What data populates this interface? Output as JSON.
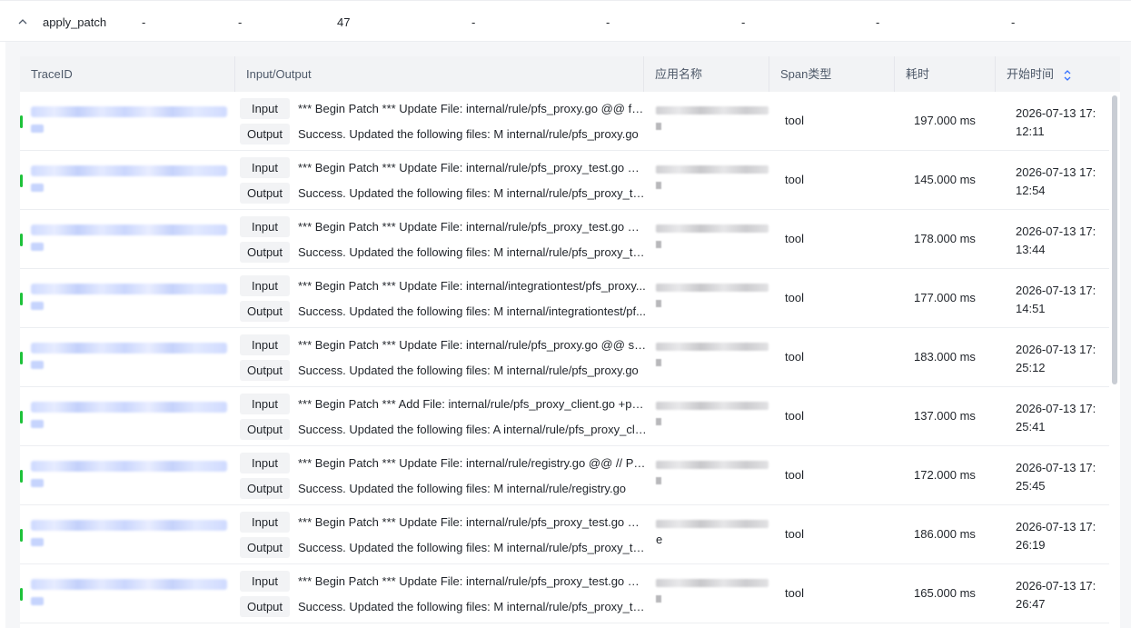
{
  "summary": {
    "name": "apply_patch",
    "cells": [
      "-",
      "-",
      "47",
      "-",
      "-",
      "-",
      "-",
      "-"
    ]
  },
  "columns": {
    "trace_id": "TraceID",
    "io": "Input/Output",
    "app_name": "应用名称",
    "span_type": "Span类型",
    "duration": "耗时",
    "start_time": "开始时间"
  },
  "io_labels": {
    "input": "Input",
    "output": "Output"
  },
  "colors": {
    "status_ok": "#1ec23a",
    "trace_link": "#c6d4ff"
  },
  "rows": [
    {
      "input": "*** Begin Patch *** Update File: internal/rule/pfs_proxy.go @@ for ...",
      "output": "Success. Updated the following files: M internal/rule/pfs_proxy.go",
      "span_type": "tool",
      "duration": "197.000 ms",
      "start_date": "2026-07-13 17:",
      "start_clock": "12:11",
      "app_tail": ""
    },
    {
      "input": "*** Begin Patch *** Update File: internal/rule/pfs_proxy_test.go @...",
      "output": "Success. Updated the following files: M internal/rule/pfs_proxy_te...",
      "span_type": "tool",
      "duration": "145.000 ms",
      "start_date": "2026-07-13 17:",
      "start_clock": "12:54",
      "app_tail": ""
    },
    {
      "input": "*** Begin Patch *** Update File: internal/rule/pfs_proxy_test.go @...",
      "output": "Success. Updated the following files: M internal/rule/pfs_proxy_te...",
      "span_type": "tool",
      "duration": "178.000 ms",
      "start_date": "2026-07-13 17:",
      "start_clock": "13:44",
      "app_tail": ""
    },
    {
      "input": "*** Begin Patch *** Update File: internal/integrationtest/pfs_proxy...",
      "output": "Success. Updated the following files: M internal/integrationtest/pf...",
      "span_type": "tool",
      "duration": "177.000 ms",
      "start_date": "2026-07-13 17:",
      "start_clock": "14:51",
      "app_tail": ""
    },
    {
      "input": "*** Begin Patch *** Update File: internal/rule/pfs_proxy.go @@ su...",
      "output": "Success. Updated the following files: M internal/rule/pfs_proxy.go",
      "span_type": "tool",
      "duration": "183.000 ms",
      "start_date": "2026-07-13 17:",
      "start_clock": "25:12",
      "app_tail": ""
    },
    {
      "input": "*** Begin Patch *** Add File: internal/rule/pfs_proxy_client.go +pa...",
      "output": "Success. Updated the following files: A internal/rule/pfs_proxy_cli...",
      "span_type": "tool",
      "duration": "137.000 ms",
      "start_date": "2026-07-13 17:",
      "start_clock": "25:41",
      "app_tail": ""
    },
    {
      "input": "*** Begin Patch *** Update File: internal/rule/registry.go @@ // PF...",
      "output": "Success. Updated the following files: M internal/rule/registry.go",
      "span_type": "tool",
      "duration": "172.000 ms",
      "start_date": "2026-07-13 17:",
      "start_clock": "25:45",
      "app_tail": ""
    },
    {
      "input": "*** Begin Patch *** Update File: internal/rule/pfs_proxy_test.go @...",
      "output": "Success. Updated the following files: M internal/rule/pfs_proxy_te...",
      "span_type": "tool",
      "duration": "186.000 ms",
      "start_date": "2026-07-13 17:",
      "start_clock": "26:19",
      "app_tail": "e"
    },
    {
      "input": "*** Begin Patch *** Update File: internal/rule/pfs_proxy_test.go @...",
      "output": "Success. Updated the following files: M internal/rule/pfs_proxy_te...",
      "span_type": "tool",
      "duration": "165.000 ms",
      "start_date": "2026-07-13 17:",
      "start_clock": "26:47",
      "app_tail": ""
    }
  ]
}
